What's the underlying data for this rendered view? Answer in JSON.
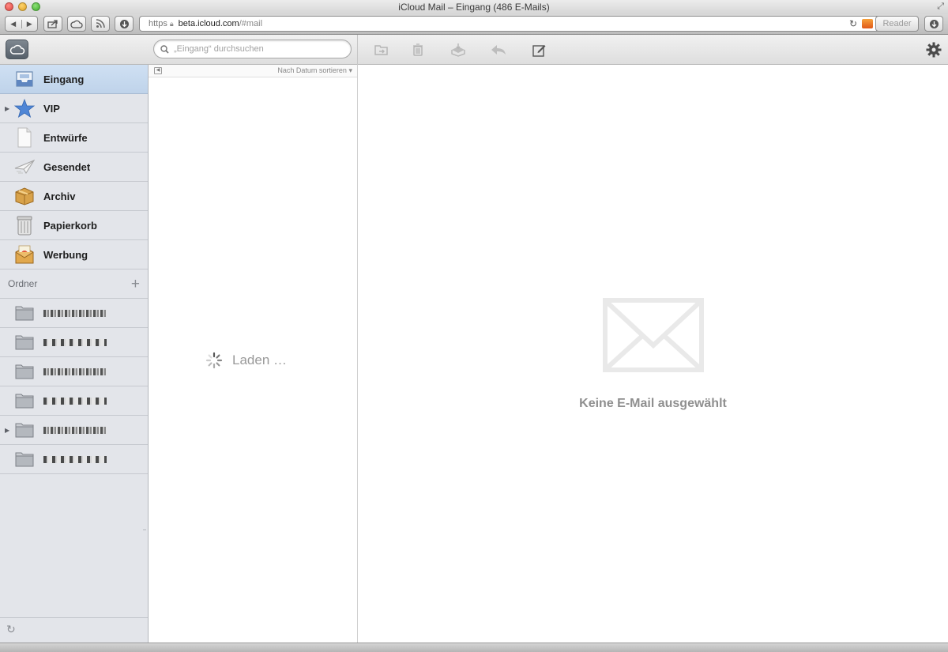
{
  "window": {
    "title": "iCloud Mail – Eingang (486 E-Mails)"
  },
  "browser": {
    "url_scheme": "https",
    "url_domain": "beta.icloud.com",
    "url_path": "/#mail",
    "reader_label": "Reader",
    "back_glyph": "◀",
    "forward_glyph": "▶"
  },
  "search": {
    "placeholder": "„Eingang“ durchsuchen"
  },
  "sidebar": {
    "mailboxes": [
      {
        "label": "Eingang",
        "icon": "inbox-icon",
        "selected": true
      },
      {
        "label": "VIP",
        "icon": "vip-star-icon",
        "expandable": true
      },
      {
        "label": "Entwürfe",
        "icon": "drafts-icon"
      },
      {
        "label": "Gesendet",
        "icon": "sent-paperplane-icon"
      },
      {
        "label": "Archiv",
        "icon": "archive-box-icon"
      },
      {
        "label": "Papierkorb",
        "icon": "trash-can-icon"
      },
      {
        "label": "Werbung",
        "icon": "junk-icon"
      }
    ],
    "folders_header": "Ordner",
    "add_folder_glyph": "+",
    "folders_count_redacted": 6,
    "refresh_glyph": "↻"
  },
  "message_list": {
    "sort_label": "Nach Datum sortieren",
    "loading_text": "Laden …"
  },
  "detail": {
    "empty_text": "Keine E-Mail ausgewählt"
  },
  "colors": {
    "selected_row": "#c7d9ee",
    "sidebar_bg": "#e3e5ea",
    "muted_text": "#8f8f8f"
  }
}
